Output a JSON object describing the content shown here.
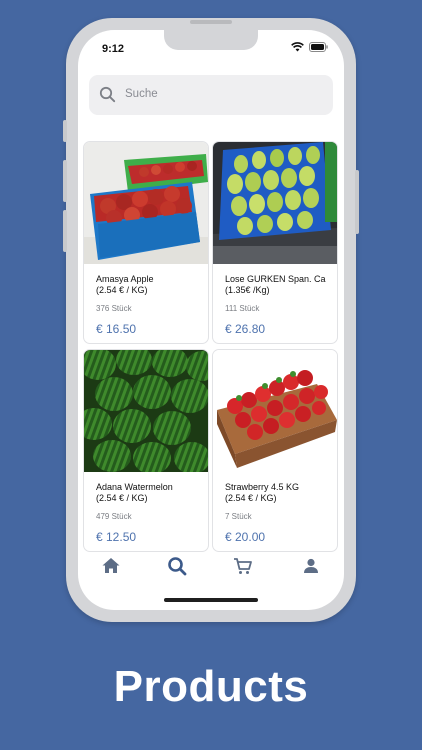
{
  "status_bar": {
    "time": "9:12"
  },
  "search": {
    "placeholder": "Suche"
  },
  "products": [
    {
      "name": "Amasya Apple\n(2.54 € / KG)",
      "stock": "376 Stück",
      "price": "€ 16.50"
    },
    {
      "name": "Lose GURKEN Span. Ca\n(1.35€ /Kg)",
      "stock": "111 Stück",
      "price": "€ 26.80"
    },
    {
      "name": "Adana Watermelon\n(2.54 € / KG)",
      "stock": "479 Stück",
      "price": "€ 12.50"
    },
    {
      "name": "Strawberry 4.5 KG\n(2.54 € / KG)",
      "stock": "7 Stück",
      "price": "€ 20.00"
    }
  ],
  "tabbar": {
    "active": "search",
    "tabs": [
      "home-icon",
      "search-icon",
      "cart-icon",
      "profile-icon"
    ]
  },
  "caption": "Products",
  "colors": {
    "background": "#4567a1",
    "price": "#4f73ae",
    "active_tab": "#3c5a8a"
  }
}
